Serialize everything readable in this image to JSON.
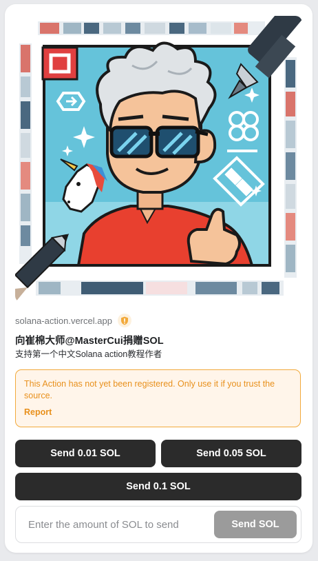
{
  "blink": {
    "domain": "solana-action.vercel.app",
    "title": "向崔棉大师@MasterCui捐赠SOL",
    "description": "支持第一个中文Solana action教程作者",
    "image_alt": "pixel-art avatar of a silver-haired man with sunglasses and a unicorn",
    "verify_icon": "shield-warning-icon"
  },
  "warning": {
    "message": "This Action has not yet been registered. Only use it if you trust the source.",
    "link_label": "Report"
  },
  "actions": {
    "buttons": [
      {
        "label": "Send 0.01 SOL"
      },
      {
        "label": "Send 0.05 SOL"
      },
      {
        "label": "Send 0.1 SOL"
      }
    ],
    "custom": {
      "placeholder": "Enter the amount of SOL to send",
      "value": "",
      "submit_label": "Send SOL"
    }
  },
  "colors": {
    "button_bg": "#2b2b2b",
    "button_disabled_bg": "#9b9b9b",
    "warning_text": "#e8901c",
    "warning_border": "#f2a93a",
    "warning_bg": "#fff5ea"
  }
}
